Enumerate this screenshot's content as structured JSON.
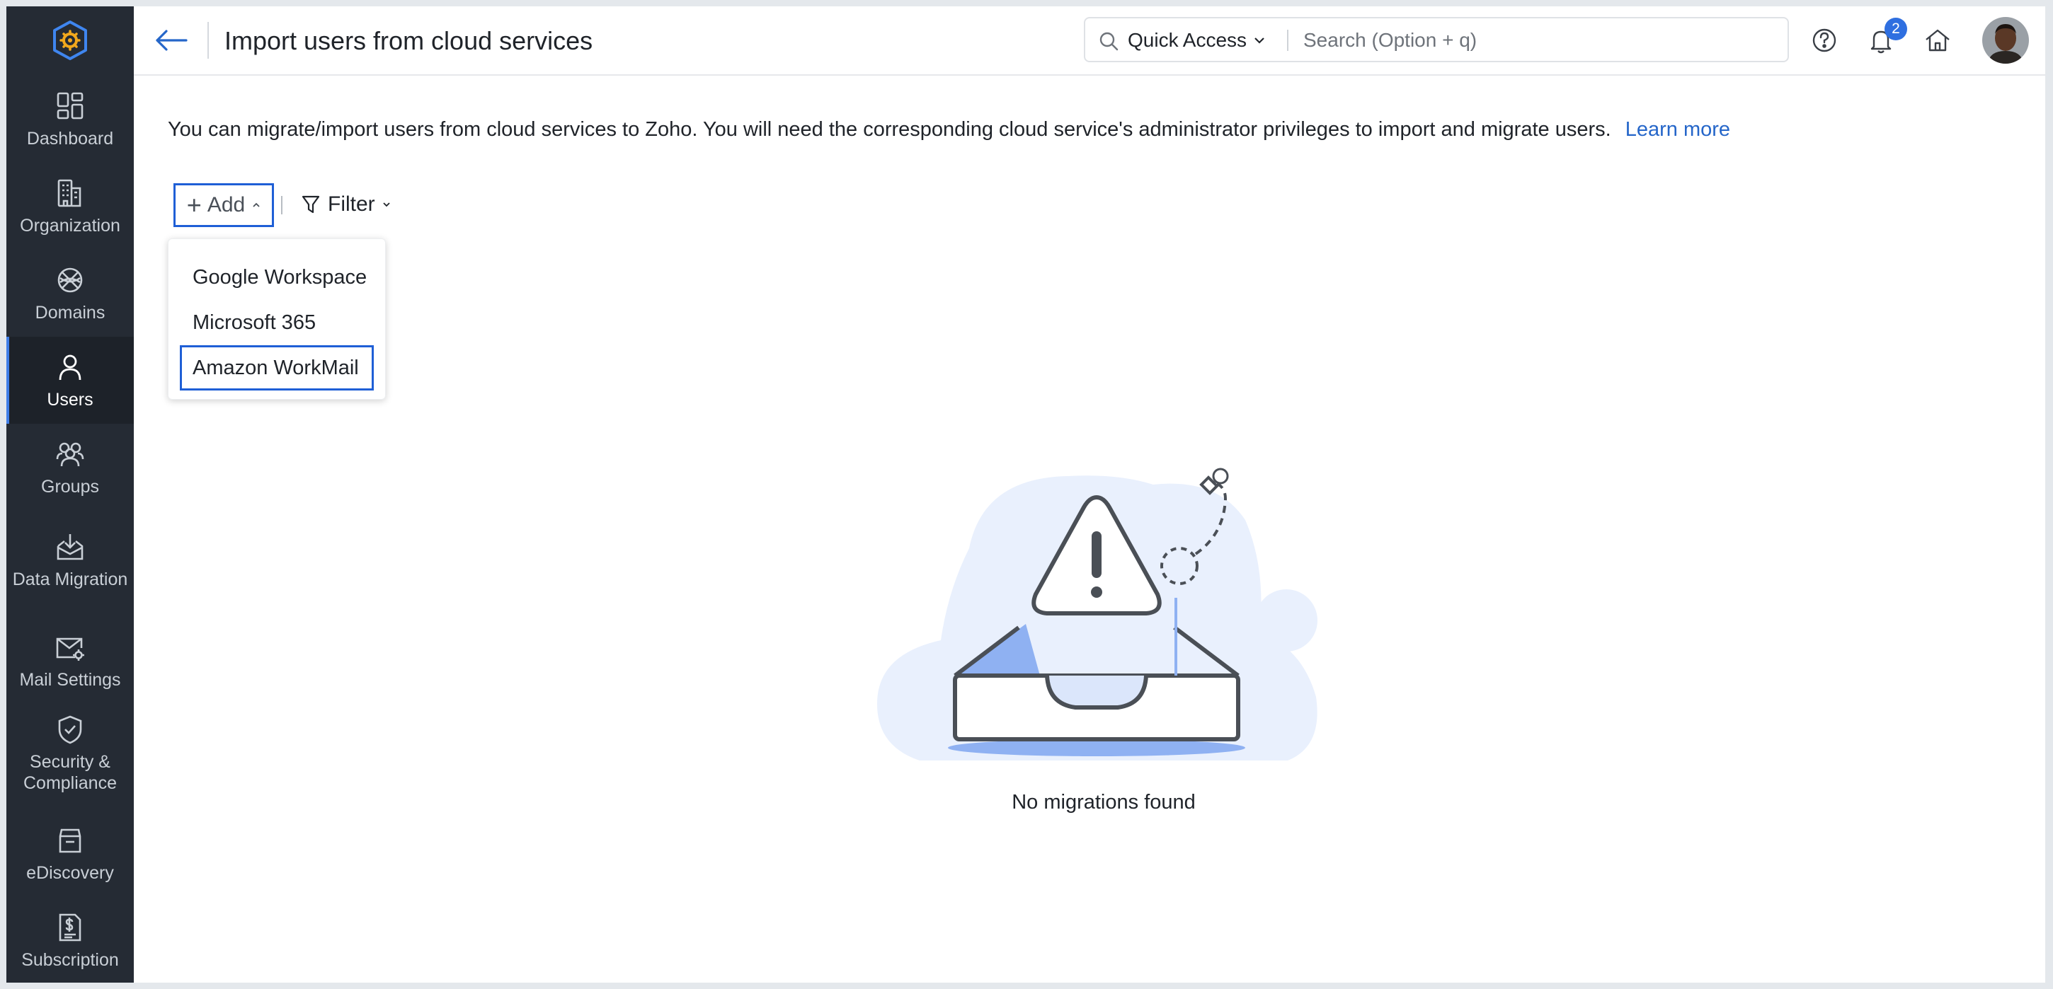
{
  "header": {
    "title": "Import users from cloud services",
    "quick_access_label": "Quick Access",
    "search_placeholder": "Search (Option + q)",
    "notification_count": "2"
  },
  "sidebar": {
    "items": [
      {
        "label": "Dashboard",
        "icon": "dashboard-icon"
      },
      {
        "label": "Organization",
        "icon": "building-icon"
      },
      {
        "label": "Domains",
        "icon": "globe-icon"
      },
      {
        "label": "Users",
        "icon": "user-icon",
        "active": true
      },
      {
        "label": "Groups",
        "icon": "groups-icon"
      },
      {
        "label": "Data Migration",
        "icon": "inbox-download-icon"
      },
      {
        "label": "Mail Settings",
        "icon": "mail-gear-icon"
      },
      {
        "label": "Security & Compliance",
        "icon": "shield-check-icon"
      },
      {
        "label": "eDiscovery",
        "icon": "archive-icon"
      },
      {
        "label": "Subscription",
        "icon": "dollar-document-icon"
      }
    ]
  },
  "main": {
    "description": "You can migrate/import users from cloud services to Zoho. You will need the corresponding cloud service's administrator privileges to import and migrate users.",
    "learn_more": "Learn more",
    "add_label": "Add",
    "filter_label": "Filter",
    "add_menu": [
      {
        "label": "Google Workspace"
      },
      {
        "label": "Microsoft 365"
      },
      {
        "label": "Amazon WorkMail",
        "selected": true
      }
    ],
    "empty_state": "No migrations found"
  },
  "colors": {
    "sidebar_bg": "#252b34",
    "accent": "#2f6fe0",
    "link": "#2566c9",
    "selection_border": "#1f5fd6",
    "illustration_blob": "#e9f0fd",
    "illustration_accent": "#8fb1f2"
  }
}
